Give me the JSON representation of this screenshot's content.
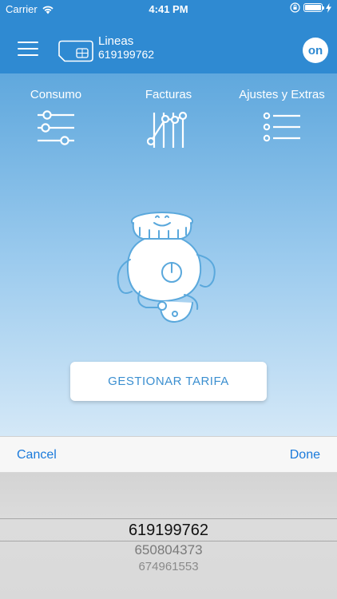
{
  "status_bar": {
    "carrier": "Carrier",
    "time": "4:41 PM",
    "icons": [
      "wifi-icon",
      "lock-rotation-icon",
      "battery-icon",
      "charging-icon"
    ]
  },
  "nav": {
    "menu_icon": "hamburger-icon",
    "sim_icon": "sim-card-icon",
    "title": "Lineas",
    "phone_number": "619199762",
    "on_button_label": "on"
  },
  "shortcuts": [
    {
      "label": "Consumo",
      "icon": "sliders-icon"
    },
    {
      "label": "Facturas",
      "icon": "chart-line-icon"
    },
    {
      "label": "Ajustes y Extras",
      "icon": "list-icon"
    }
  ],
  "mascot": "robot-mascot",
  "main_button": {
    "label": "GESTIONAR TARIFA"
  },
  "picker_toolbar": {
    "cancel": "Cancel",
    "done": "Done"
  },
  "picker": {
    "options": [
      "619199762",
      "650804373",
      "674961553"
    ],
    "selected": "619199762"
  },
  "colors": {
    "header_blue": "#2f8ad2",
    "link_blue": "#1a7adb",
    "button_text": "#3b8fd0"
  }
}
